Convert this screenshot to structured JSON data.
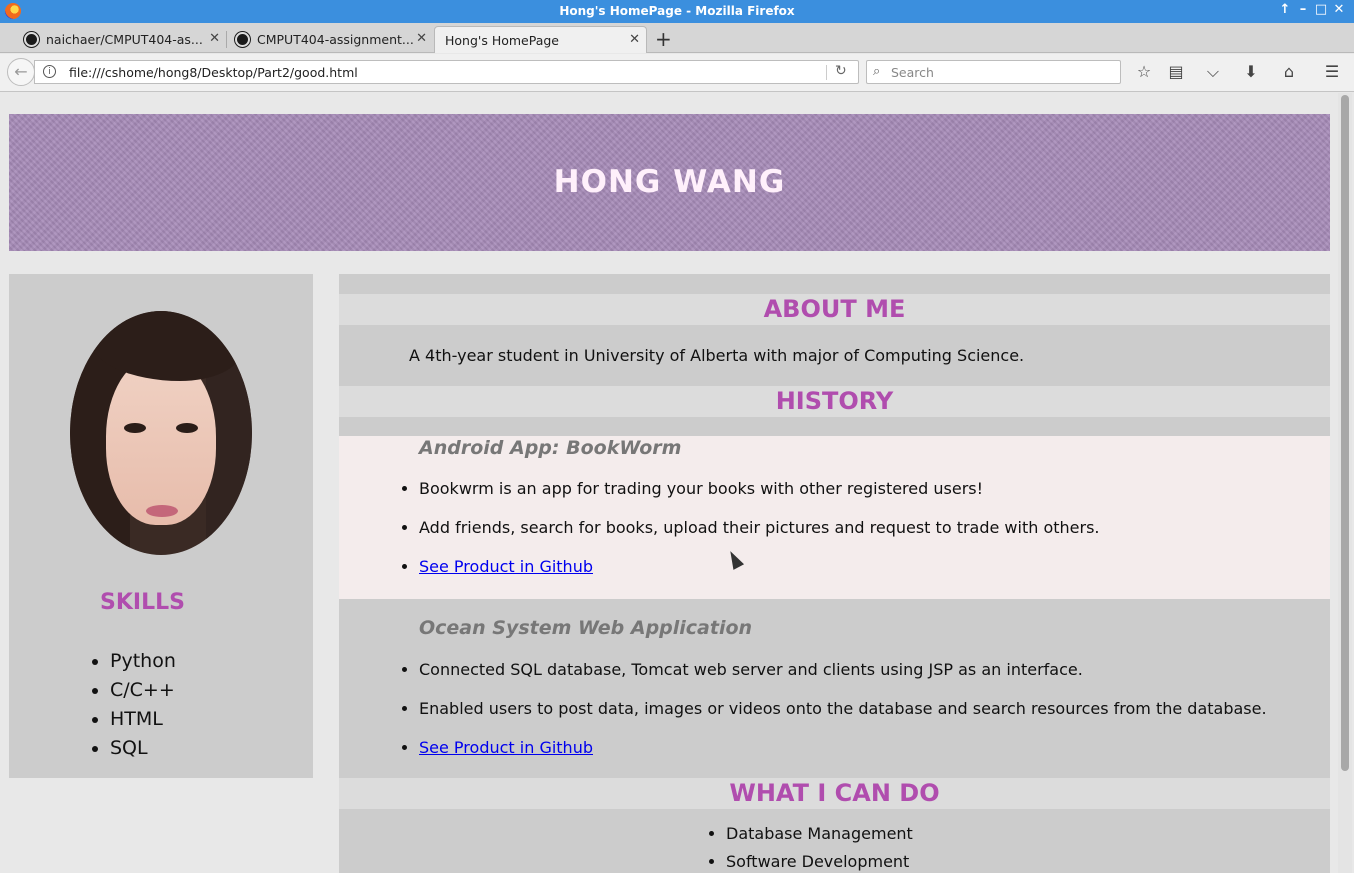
{
  "window": {
    "title": "Hong's HomePage - Mozilla Firefox"
  },
  "tabs": [
    {
      "label": "naichaer/CMPUT404-as..."
    },
    {
      "label": "CMPUT404-assignment..."
    },
    {
      "label": "Hong's HomePage"
    }
  ],
  "navbar": {
    "url": "file:///cshome/hong8/Desktop/Part2/good.html",
    "search_placeholder": "Search"
  },
  "page": {
    "banner_title": "HONG WANG",
    "skills": {
      "title": "SKILLS",
      "items": [
        "Python",
        "C/C++",
        "HTML",
        "SQL"
      ]
    },
    "about": {
      "title": "ABOUT ME",
      "text": "A 4th-year student in University of Alberta with major of Computing Science."
    },
    "history": {
      "title": "HISTORY",
      "projects": [
        {
          "title": "Android App: BookWorm",
          "points": [
            "Bookwrm is an app for trading your books with other registered users!",
            "Add friends, search for books, upload their pictures and request to trade with others."
          ],
          "link": "See Product in Github"
        },
        {
          "title": "Ocean System Web Application",
          "points": [
            "Connected SQL database, Tomcat web server and clients using JSP as an interface.",
            "Enabled users to post data, images or videos onto the database and search resources from the database."
          ],
          "link": "See Product in Github"
        }
      ]
    },
    "cando": {
      "title": "WHAT I CAN DO",
      "items": [
        "Database Management",
        "Software Development"
      ]
    }
  },
  "colors": {
    "accent": "#b04dae",
    "link": "#0000ee",
    "banner": "#a78bb8"
  }
}
